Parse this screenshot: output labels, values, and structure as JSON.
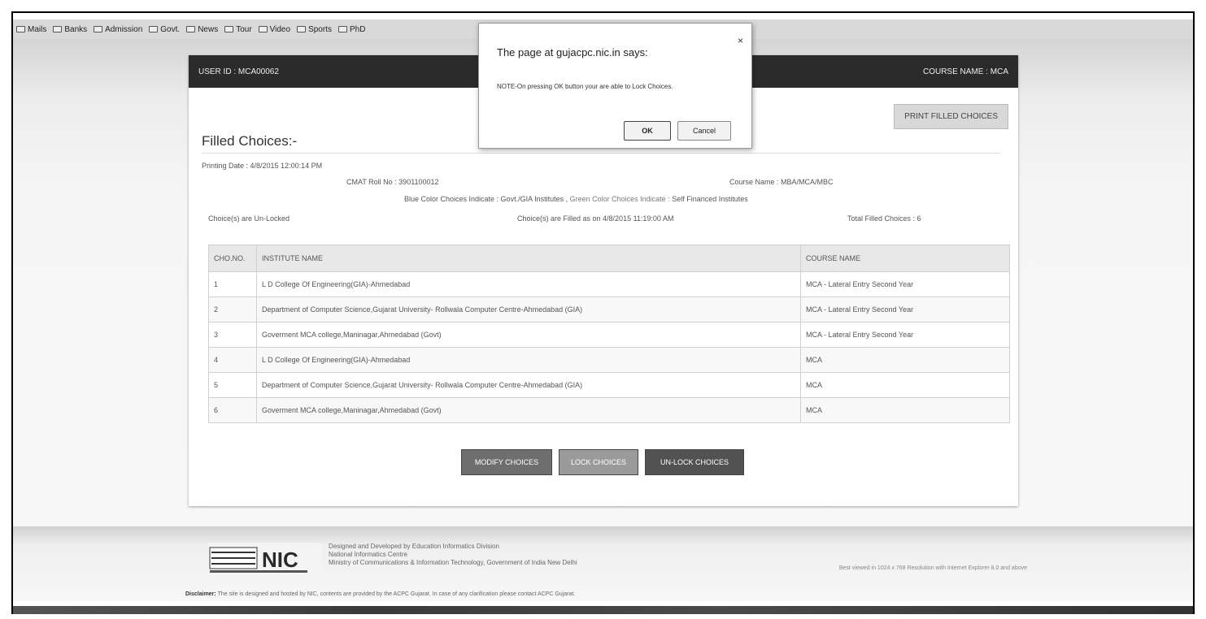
{
  "bookmarks": [
    "Mails",
    "Banks",
    "Admission",
    "Govt.",
    "News",
    "Tour",
    "Video",
    "Sports",
    "PhD"
  ],
  "header": {
    "user_id": "USER ID : MCA00062",
    "course_name": "COURSE NAME : MCA"
  },
  "print_button": "PRINT FILLED CHOICES",
  "filled_title": "Filled Choices:-",
  "info": {
    "printing_date": "Printing Date : 4/8/2015 12:00:14 PM",
    "cmat_roll": "CMAT Roll No : 3901100012",
    "course_name": "Course Name : MBA/MCA/MBC",
    "legend_blue": "Blue Color Choices Indicate : Govt./GIA Institutes ,",
    "legend_green": "Green Color Choices Indicate :",
    "legend_self": "Self Financed Institutes",
    "lock_status": "Choice(s) are Un-Locked",
    "filled_on": "Choice(s) are Filled as on 4/8/2015 11:19:00 AM",
    "total": "Total Filled Choices : 6"
  },
  "table": {
    "headers": [
      "CHO.NO.",
      "INSTITUTE NAME",
      "COURSE NAME"
    ],
    "rows": [
      [
        "1",
        "L D College Of Engineering(GIA)-Ahmedabad",
        "MCA - Lateral Entry Second Year"
      ],
      [
        "2",
        "Department of Computer Science,Gujarat University- Rollwala Computer Centre-Ahmedabad (GIA)",
        "MCA - Lateral Entry Second Year"
      ],
      [
        "3",
        "Goverment MCA college,Maninagar,Ahmedabad (Govt)",
        "MCA - Lateral Entry Second Year"
      ],
      [
        "4",
        "L D College Of Engineering(GIA)-Ahmedabad",
        "MCA"
      ],
      [
        "5",
        "Department of Computer Science,Gujarat University- Rollwala Computer Centre-Ahmedabad (GIA)",
        "MCA"
      ],
      [
        "6",
        "Goverment MCA college,Maninagar,Ahmedabad (Govt)",
        "MCA"
      ]
    ]
  },
  "actions": {
    "modify": "MODIFY CHOICES",
    "lock": "LOCK CHOICES",
    "unlock": "UN-LOCK CHOICES"
  },
  "footer": {
    "logo_text": "NATIONAL INFORMATICS CENTRE NIC",
    "line1": "Designed and Developed by Education Informatics Division",
    "line2": "National Informatics Centre",
    "line3": "Ministry of Communications & Information Technology, Government of India New Delhi",
    "best_viewed": "Best viewed in 1024 x 768 Resolution with Internet Explorer 8.0 and above",
    "disclaimer_label": "Disclaimer:",
    "disclaimer_text": " The site is designed and hosted by NIC, contents are provided by the ACPC Gujarat. In case of any clarification please contact ACPC Gujarat."
  },
  "dialog": {
    "title": "The page at gujacpc.nic.in says:",
    "close": "×",
    "message": "NOTE-On pressing OK button your are able to  Lock Choices.",
    "ok": "OK",
    "cancel": "Cancel"
  }
}
